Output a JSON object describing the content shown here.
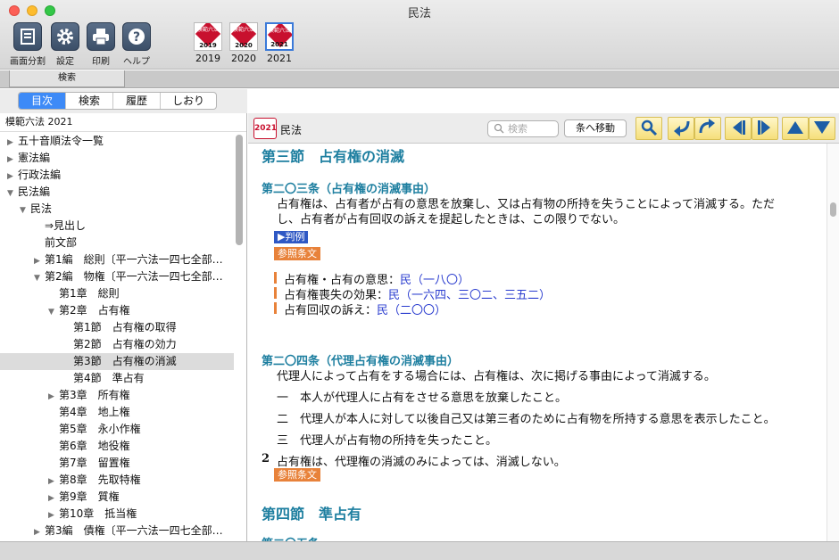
{
  "window": {
    "title": "民法"
  },
  "toolbar": {
    "tools": [
      {
        "label": "画面分割",
        "icon": "split-screen-icon"
      },
      {
        "label": "設定",
        "icon": "gear-icon"
      },
      {
        "label": "印刷",
        "icon": "printer-icon"
      },
      {
        "label": "ヘルプ",
        "icon": "help-icon"
      }
    ],
    "books": [
      {
        "label": "2019",
        "cover_text": "模範六法",
        "cover_year": "2019"
      },
      {
        "label": "2020",
        "cover_text": "模範六法",
        "cover_year": "2020"
      },
      {
        "label": "2021",
        "cover_text": "模範六法",
        "cover_year": "2021",
        "selected": true
      }
    ],
    "search_tab": "検索"
  },
  "sidebar": {
    "tabs": [
      "目次",
      "検索",
      "履歴",
      "しおり"
    ],
    "active_tab": "目次",
    "header": "模範六法 2021",
    "tree": [
      {
        "label": "五十音順法令一覧",
        "arrow": "▶",
        "level": 0
      },
      {
        "label": "憲法編",
        "arrow": "▶",
        "level": 0
      },
      {
        "label": "行政法編",
        "arrow": "▶",
        "level": 0
      },
      {
        "label": "民法編",
        "arrow": "▼",
        "level": 0
      },
      {
        "label": "民法",
        "arrow": "▼",
        "level": 1
      },
      {
        "label": "⇒見出し",
        "arrow": "",
        "level": 2
      },
      {
        "label": "前文部",
        "arrow": "",
        "level": 2
      },
      {
        "label": "第1編　総則〔平一六法一四七全部…",
        "arrow": "▶",
        "level": 2
      },
      {
        "label": "第2編　物権〔平一六法一四七全部…",
        "arrow": "▼",
        "level": 2
      },
      {
        "label": "第1章　総則",
        "arrow": "",
        "level": 3
      },
      {
        "label": "第2章　占有権",
        "arrow": "▼",
        "level": 3
      },
      {
        "label": "第1節　占有権の取得",
        "arrow": "",
        "level": 4
      },
      {
        "label": "第2節　占有権の効力",
        "arrow": "",
        "level": 4
      },
      {
        "label": "第3節　占有権の消滅",
        "arrow": "",
        "level": 4,
        "selected": true
      },
      {
        "label": "第4節　準占有",
        "arrow": "",
        "level": 4
      },
      {
        "label": "第3章　所有権",
        "arrow": "▶",
        "level": 3
      },
      {
        "label": "第4章　地上権",
        "arrow": "",
        "level": 3
      },
      {
        "label": "第5章　永小作権",
        "arrow": "",
        "level": 3
      },
      {
        "label": "第6章　地役権",
        "arrow": "",
        "level": 3
      },
      {
        "label": "第7章　留置権",
        "arrow": "",
        "level": 3
      },
      {
        "label": "第8章　先取特権",
        "arrow": "▶",
        "level": 3
      },
      {
        "label": "第9章　質権",
        "arrow": "▶",
        "level": 3
      },
      {
        "label": "第10章　抵当権",
        "arrow": "▶",
        "level": 3
      },
      {
        "label": "第3編　債権〔平一六法一四七全部…",
        "arrow": "▶",
        "level": 2
      }
    ]
  },
  "content_header": {
    "badge": "2021",
    "law_name": "民法",
    "search_placeholder": "検索",
    "goto_button": "条へ移動",
    "nav_icons": [
      "search-icon",
      "back-icon",
      "forward-icon",
      "previous-icon",
      "next-icon",
      "up-icon",
      "down-icon"
    ]
  },
  "content": {
    "section_title": "第三節　占有権の消滅",
    "art203": {
      "title": "第二〇三条（占有権の消滅事由）",
      "line1": "占有権は、占有者が占有の意思を放棄し、又は占有物の所持を失うことによって消滅する。ただ",
      "line2": "し、占有者が占有回収の訴えを提起したときは、この限りでない。",
      "tag_cases": "▶判例",
      "tag_refs": "参照条文",
      "refs": [
        {
          "label": "占有権・占有の意思：",
          "links": [
            "民（一八〇）"
          ]
        },
        {
          "label": "占有権喪失の効果：",
          "links": [
            "民（一六四、",
            "三〇二、",
            "三五二）"
          ]
        },
        {
          "label": "占有回収の訴え：",
          "links": [
            "民（二〇〇）"
          ]
        }
      ]
    },
    "art204": {
      "title": "第二〇四条（代理占有権の消滅事由）",
      "line1": "代理人によって占有をする場合には、占有権は、次に掲げる事由によって消滅する。",
      "item1": "一　本人が代理人に占有をさせる意思を放棄したこと。",
      "item2": "二　代理人が本人に対して以後自己又は第三者のために占有物を所持する意思を表示したこと。",
      "item3": "三　代理人が占有物の所持を失ったこと。",
      "para2_num": "2",
      "para2": "占有権は、代理権の消滅のみによっては、消滅しない。",
      "tag_refs": "参照条文"
    },
    "section4_title": "第四節　準占有",
    "art205_partial": "第二〇五条"
  }
}
